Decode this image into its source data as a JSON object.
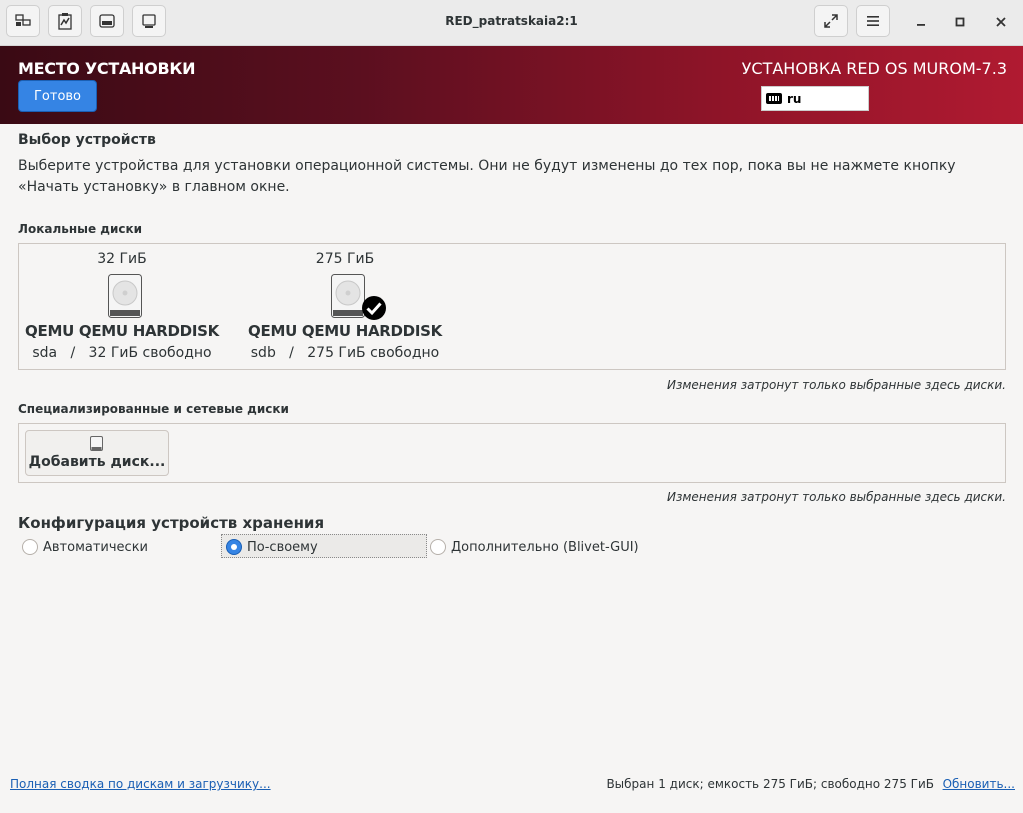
{
  "window": {
    "title": "RED_patratskaia2:1",
    "toolbar_icons": [
      "display-icon",
      "clipboard-icon",
      "keyboard-icon",
      "screen-icon"
    ],
    "controls": [
      "fullscreen-icon",
      "menu-icon",
      "minimize-icon",
      "maximize-icon",
      "close-icon"
    ]
  },
  "header": {
    "title": "МЕСТО УСТАНОВКИ",
    "done_label": "Готово",
    "product": "УСТАНОВКА RED OS MUROM-7.3",
    "keyboard_layout": "ru"
  },
  "devices": {
    "title": "Выбор устройств",
    "description": "Выберите устройства для установки операционной системы. Они не будут изменены до тех пор, пока вы не нажмете кнопку «Начать установку» в главном окне."
  },
  "local_disks": {
    "title": "Локальные диски",
    "disks": [
      {
        "size": "32 ГиБ",
        "name": "QEMU QEMU HARDDISK",
        "info": "sda   /   32 ГиБ свободно",
        "selected": false
      },
      {
        "size": "275 ГиБ",
        "name": "QEMU QEMU HARDDISK",
        "info": "sdb   /   275 ГиБ свободно",
        "selected": true
      }
    ],
    "note": "Изменения затронут только выбранные здесь диски."
  },
  "network_disks": {
    "title": "Специализированные и сетевые диски",
    "add_label": "Добавить диск...",
    "note": "Изменения затронут только выбранные здесь диски."
  },
  "storage_config": {
    "title": "Конфигурация устройств хранения",
    "options": [
      {
        "label": "Автоматически",
        "selected": false
      },
      {
        "label": "По-своему",
        "selected": true
      },
      {
        "label": "Дополнительно (Blivet-GUI)",
        "selected": false
      }
    ]
  },
  "footer": {
    "summary_link": "Полная сводка по дискам и загрузчику...",
    "status": "Выбран 1 диск; емкость 275 ГиБ; свободно 275 ГиБ",
    "refresh_link": "Обновить..."
  },
  "colors": {
    "accent": "#3584e4",
    "header_dark": "#3a0a14",
    "header_light": "#b01a31",
    "link": "#1a5fb4"
  }
}
